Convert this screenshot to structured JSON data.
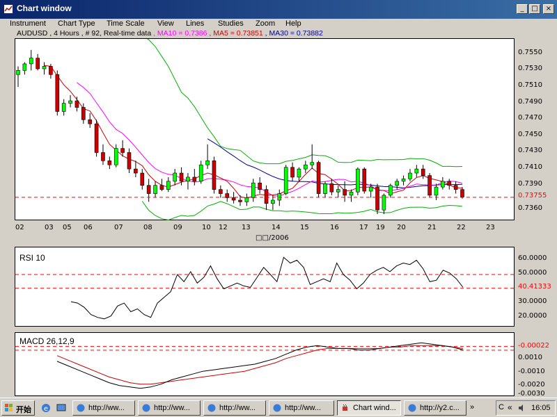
{
  "window": {
    "title": "Chart window",
    "buttons": [
      "_",
      "□",
      "×"
    ]
  },
  "menu": [
    "Instrument",
    "Chart Type",
    "Time Scale",
    "View",
    "Lines",
    "Studies",
    "Zoom",
    "Help"
  ],
  "info": {
    "symbol": "AUDUSD , 4 Hours , # 92, Real-time data",
    "ma10": ", MA10 = 0.7386",
    "ma5": ", MA5 = 0.73851",
    "ma30": ", MA30 = 0.73882"
  },
  "colors": {
    "ma10": "#ff00ff",
    "ma5": "#cc0000",
    "ma30": "#000099",
    "bands": "#00b000",
    "up": "#00ff00",
    "down": "#cc0000",
    "ref": "#ff0000"
  },
  "price_chart": {
    "y_ticks": [
      "0.7550",
      "0.7530",
      "0.7510",
      "0.7490",
      "0.7470",
      "0.7450",
      "0.7430",
      "0.7410",
      "0.7390",
      "0.7360"
    ],
    "current_price": "0.73755",
    "x_ticks": [
      "02",
      "03",
      "05",
      "06",
      "07",
      "08",
      "09",
      "10",
      "12",
      "13",
      "14",
      "15",
      "16",
      "17",
      "19",
      "20",
      "21",
      "22",
      "23"
    ],
    "date_label": "□□/2006"
  },
  "rsi": {
    "title": "RSI 10",
    "y_ticks": [
      "60.0000",
      "50.0000",
      "30.0000",
      "20.0000"
    ],
    "current": "40.41333"
  },
  "macd": {
    "title": "MACD 26,12,9",
    "y_ticks": [
      "0.0010",
      "-0.0010",
      "-0.0020",
      "-0.0030"
    ],
    "current": "-0.00022"
  },
  "taskbar": {
    "start": "开始",
    "tasks": [
      "http://ww...",
      "http://ww...",
      "http://ww...",
      "http://ww...",
      "Chart wind...",
      "http://y2.c..."
    ],
    "tray_text": "C",
    "clock": "16:05"
  },
  "chart_data": {
    "type": "candlestick",
    "note_series": [
      "candles",
      "MA5",
      "MA10",
      "MA30",
      "bollinger_upper",
      "bollinger_lower",
      "RSI 10",
      "MACD 26,12,9",
      "signal"
    ],
    "candles": [
      [
        0.7525,
        0.7535,
        0.751,
        0.753
      ],
      [
        0.753,
        0.754,
        0.7525,
        0.7538
      ],
      [
        0.7538,
        0.7555,
        0.753,
        0.7545
      ],
      [
        0.7545,
        0.755,
        0.753,
        0.7532
      ],
      [
        0.7532,
        0.754,
        0.7525,
        0.7535
      ],
      [
        0.7535,
        0.7538,
        0.752,
        0.7525
      ],
      [
        0.7525,
        0.753,
        0.7475,
        0.748
      ],
      [
        0.748,
        0.7495,
        0.7475,
        0.749
      ],
      [
        0.749,
        0.75,
        0.7485,
        0.7493
      ],
      [
        0.7493,
        0.7498,
        0.748,
        0.7485
      ],
      [
        0.7485,
        0.749,
        0.7465,
        0.747
      ],
      [
        0.747,
        0.7478,
        0.746,
        0.7465
      ],
      [
        0.7465,
        0.747,
        0.7425,
        0.743
      ],
      [
        0.743,
        0.744,
        0.7415,
        0.742
      ],
      [
        0.742,
        0.7425,
        0.741,
        0.7415
      ],
      [
        0.7415,
        0.744,
        0.7412,
        0.7435
      ],
      [
        0.7435,
        0.7445,
        0.7425,
        0.743
      ],
      [
        0.743,
        0.7435,
        0.7405,
        0.741
      ],
      [
        0.741,
        0.742,
        0.74,
        0.7405
      ],
      [
        0.7405,
        0.741,
        0.7385,
        0.739
      ],
      [
        0.739,
        0.7398,
        0.737,
        0.738
      ],
      [
        0.738,
        0.7395,
        0.7375,
        0.739
      ],
      [
        0.739,
        0.7398,
        0.7383,
        0.7385
      ],
      [
        0.7385,
        0.74,
        0.7382,
        0.7395
      ],
      [
        0.7395,
        0.741,
        0.739,
        0.7405
      ],
      [
        0.7405,
        0.7412,
        0.739,
        0.7395
      ],
      [
        0.7395,
        0.7405,
        0.7385,
        0.74
      ],
      [
        0.74,
        0.741,
        0.739,
        0.7395
      ],
      [
        0.7395,
        0.742,
        0.7392,
        0.7415
      ],
      [
        0.7415,
        0.744,
        0.741,
        0.742
      ],
      [
        0.742,
        0.7425,
        0.738,
        0.7385
      ],
      [
        0.7385,
        0.739,
        0.7375,
        0.738
      ],
      [
        0.738,
        0.7385,
        0.737,
        0.7375
      ],
      [
        0.7375,
        0.7382,
        0.7368,
        0.7372
      ],
      [
        0.7372,
        0.7378,
        0.7365,
        0.737
      ],
      [
        0.737,
        0.738,
        0.7365,
        0.7375
      ],
      [
        0.7375,
        0.7398,
        0.737,
        0.7393
      ],
      [
        0.7393,
        0.74,
        0.738,
        0.7385
      ],
      [
        0.7385,
        0.739,
        0.736,
        0.7368
      ],
      [
        0.7368,
        0.7378,
        0.736,
        0.7372
      ],
      [
        0.7372,
        0.7385,
        0.7365,
        0.738
      ],
      [
        0.738,
        0.7415,
        0.7378,
        0.7412
      ],
      [
        0.7412,
        0.7418,
        0.7395,
        0.74
      ],
      [
        0.74,
        0.7412,
        0.7395,
        0.741
      ],
      [
        0.741,
        0.742,
        0.7405,
        0.7415
      ],
      [
        0.7415,
        0.744,
        0.741,
        0.7418
      ],
      [
        0.7418,
        0.742,
        0.7375,
        0.738
      ],
      [
        0.738,
        0.7395,
        0.7375,
        0.7392
      ],
      [
        0.7392,
        0.7398,
        0.7378,
        0.7382
      ],
      [
        0.7382,
        0.739,
        0.7375,
        0.7385
      ],
      [
        0.7385,
        0.7395,
        0.737,
        0.7378
      ],
      [
        0.7378,
        0.7385,
        0.737,
        0.7382
      ],
      [
        0.7382,
        0.7412,
        0.7378,
        0.741
      ],
      [
        0.741,
        0.7412,
        0.738,
        0.7383
      ],
      [
        0.7383,
        0.7392,
        0.7375,
        0.7388
      ],
      [
        0.7388,
        0.7392,
        0.7355,
        0.736
      ],
      [
        0.736,
        0.738,
        0.7355,
        0.7378
      ],
      [
        0.7378,
        0.7392,
        0.7375,
        0.739
      ],
      [
        0.739,
        0.7398,
        0.7385,
        0.7395
      ],
      [
        0.7395,
        0.7402,
        0.739,
        0.7398
      ],
      [
        0.7398,
        0.741,
        0.7395,
        0.7405
      ],
      [
        0.7405,
        0.7415,
        0.74,
        0.741
      ],
      [
        0.741,
        0.7415,
        0.7398,
        0.7402
      ],
      [
        0.7402,
        0.7405,
        0.7375,
        0.7378
      ],
      [
        0.7378,
        0.7392,
        0.7372,
        0.7388
      ],
      [
        0.7388,
        0.74,
        0.7385,
        0.7395
      ],
      [
        0.7395,
        0.7398,
        0.7385,
        0.739
      ],
      [
        0.739,
        0.7395,
        0.738,
        0.7385
      ],
      [
        0.7385,
        0.7388,
        0.7374,
        0.7376
      ]
    ],
    "rsi_values": [
      31,
      30,
      27,
      22,
      20,
      19,
      21,
      28,
      30,
      24,
      26,
      22,
      20,
      30,
      34,
      38,
      50,
      45,
      52,
      44,
      48,
      56,
      47,
      40,
      42,
      44,
      42,
      41,
      48,
      55,
      50,
      45,
      62,
      58,
      60,
      55,
      43,
      45,
      47,
      45,
      58,
      50,
      46,
      40,
      44,
      50,
      53,
      55,
      52,
      56,
      58,
      57,
      60,
      54,
      45,
      46,
      53,
      51,
      47,
      41
    ],
    "macd_values": [
      -0.001,
      -0.0013,
      -0.0016,
      -0.0019,
      -0.0022,
      -0.0025,
      -0.0027,
      -0.0028,
      -0.0029,
      -0.0028,
      -0.0026,
      -0.0023,
      -0.0021,
      -0.0019,
      -0.0017,
      -0.0016,
      -0.0015,
      -0.0014,
      -0.0013,
      -0.0012,
      -0.001,
      -0.0008,
      -0.0005,
      -0.0002,
      0.0,
      0.0001,
      0.0,
      -0.0001,
      -0.0001,
      -0.0002,
      -0.0002,
      -0.0001,
      0.0,
      0.0001,
      0.0002,
      0.0003,
      0.0002,
      0.0001,
      0.0,
      -0.0002
    ],
    "signal_values": [
      -0.0006,
      -0.0009,
      -0.0012,
      -0.0015,
      -0.0018,
      -0.0021,
      -0.0023,
      -0.0025,
      -0.0026,
      -0.0026,
      -0.0025,
      -0.0024,
      -0.0023,
      -0.0022,
      -0.0021,
      -0.002,
      -0.0019,
      -0.0018,
      -0.0017,
      -0.0015,
      -0.0013,
      -0.0011,
      -0.0008,
      -0.0006,
      -0.0004,
      -0.0002,
      -0.0001,
      -0.0001,
      -0.0001,
      -0.0001,
      -0.0001,
      -0.0001,
      0.0,
      0.0,
      0.0001,
      0.0001,
      0.0001,
      0.0001,
      0.0,
      -0.0001
    ]
  }
}
